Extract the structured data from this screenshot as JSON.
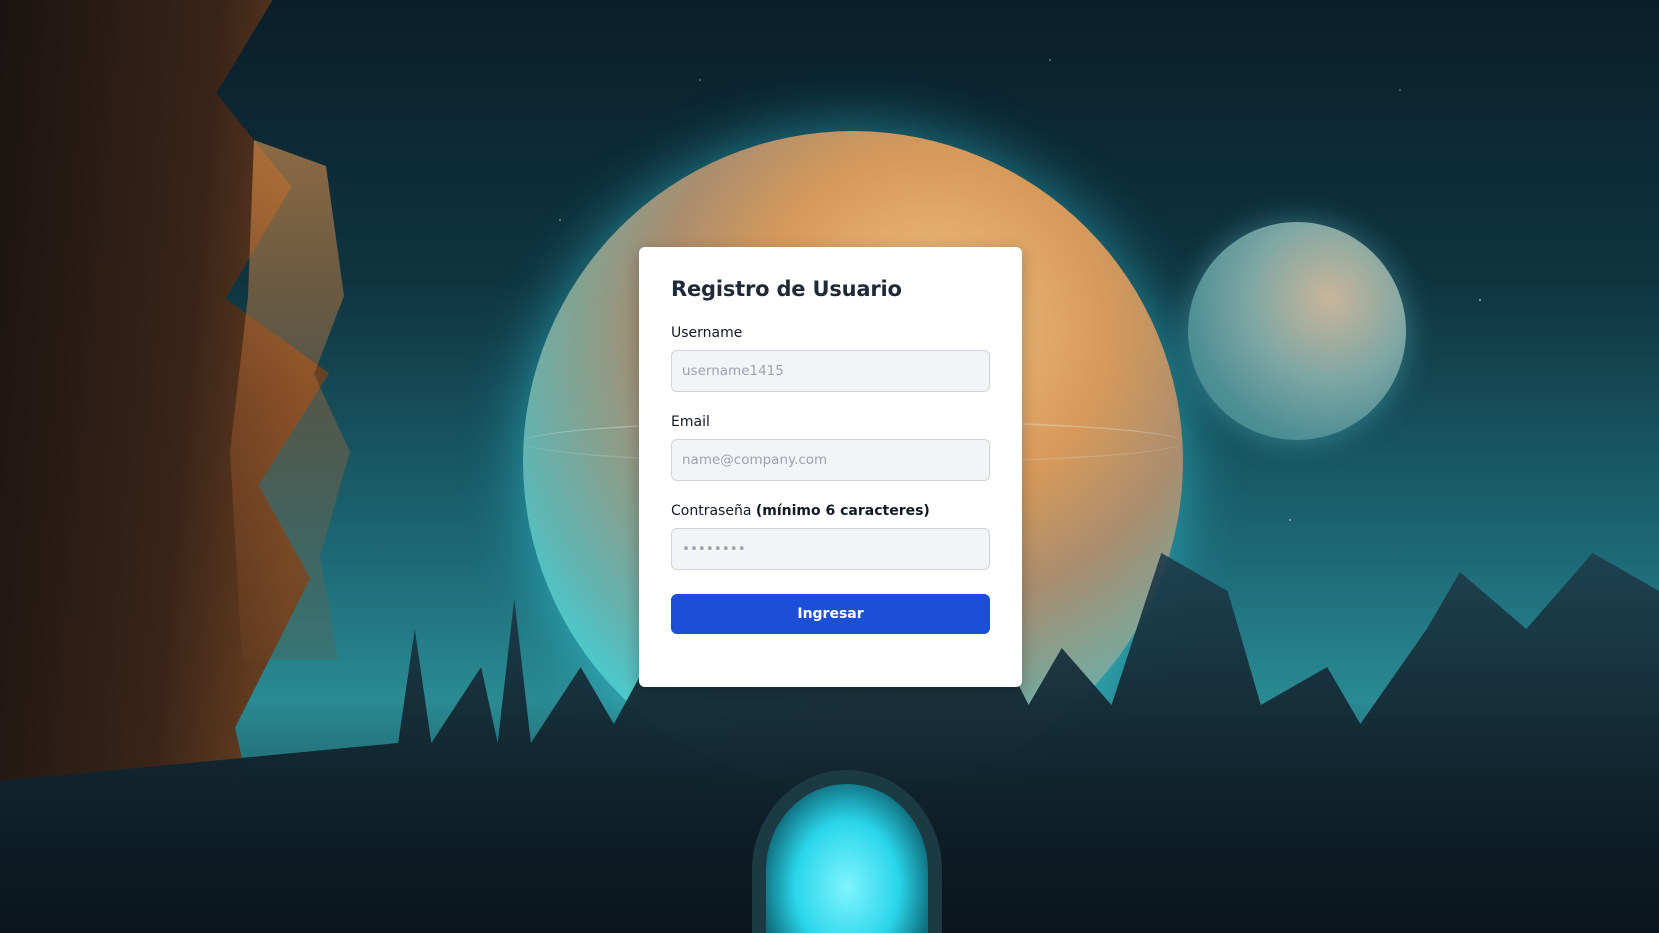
{
  "form": {
    "title": "Registro de Usuario",
    "username": {
      "label": "Username",
      "placeholder": "username1415"
    },
    "email": {
      "label": "Email",
      "placeholder": "name@company.com"
    },
    "password": {
      "label": "Contraseña",
      "hint": "(mínimo 6 caracteres)",
      "placeholder": "••••••••"
    },
    "submit_label": "Ingresar"
  },
  "colors": {
    "primary_button": "#1d4ed8",
    "card_background": "#ffffff",
    "input_background": "#f3f4f6"
  }
}
